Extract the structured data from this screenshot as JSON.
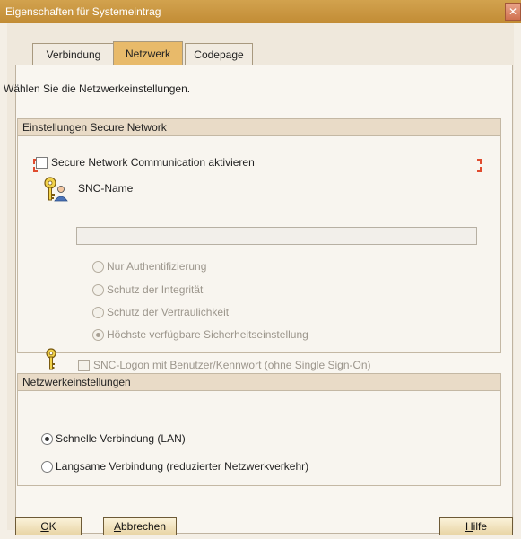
{
  "window": {
    "title": "Eigenschaften für Systemeintrag",
    "close_glyph": "✕"
  },
  "tabs": [
    {
      "label": "Verbindung",
      "active": false
    },
    {
      "label": "Netzwerk",
      "active": true
    },
    {
      "label": "Codepage",
      "active": false
    }
  ],
  "intro_text": "Wählen Sie die Netzwerkeinstellungen.",
  "secure_network": {
    "header": "Einstellungen Secure Network",
    "enable_checkbox_label": "Secure Network Communication aktivieren",
    "enable_checked": false,
    "snc_name_label": "SNC-Name",
    "snc_name_value": "",
    "options": [
      {
        "label": "Nur Authentifizierung",
        "selected": false
      },
      {
        "label": "Schutz der Integrität",
        "selected": false
      },
      {
        "label": "Schutz der Vertraulichkeit",
        "selected": false
      },
      {
        "label": "Höchste verfügbare Sicherheitseinstellung",
        "selected": true
      }
    ],
    "logon_checkbox_label": "SNC-Logon mit Benutzer/Kennwort (ohne Single Sign-On)",
    "logon_checked": false
  },
  "network_settings": {
    "header": "Netzwerkeinstellungen",
    "options": [
      {
        "label": "Schnelle Verbindung (LAN)",
        "selected": true
      },
      {
        "label": "Langsame Verbindung (reduzierter Netzwerkverkehr)",
        "selected": false
      }
    ]
  },
  "buttons": {
    "ok": "OK",
    "ok_mnemonic": "O",
    "ok_rest": "K",
    "cancel": "Abbrechen",
    "cancel_mnemonic": "A",
    "cancel_rest": "bbrechen",
    "help": "Hilfe",
    "help_mnemonic": "H",
    "help_rest": "ilfe"
  },
  "icons": {
    "key_user": "key-user-icon",
    "key": "key-icon"
  },
  "colors": {
    "titlebar": "#c8963f",
    "active_tab": "#e8ba6a",
    "focus_marker": "#e04b2e"
  }
}
